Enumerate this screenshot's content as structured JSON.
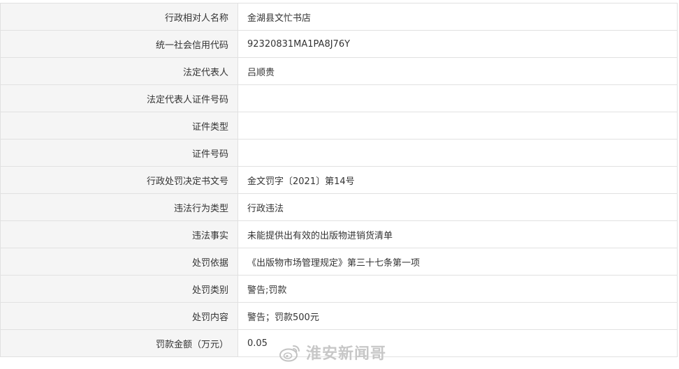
{
  "rows": [
    {
      "label": "行政相对人名称",
      "value": "金湖县文忙书店"
    },
    {
      "label": "统一社会信用代码",
      "value": "92320831MA1PA8J76Y"
    },
    {
      "label": "法定代表人",
      "value": "吕顺贵"
    },
    {
      "label": "法定代表人证件号码",
      "value": ""
    },
    {
      "label": "证件类型",
      "value": ""
    },
    {
      "label": "证件号码",
      "value": ""
    },
    {
      "label": "行政处罚决定书文号",
      "value": "金文罚字〔2021〕第14号"
    },
    {
      "label": "违法行为类型",
      "value": "行政违法"
    },
    {
      "label": "违法事实",
      "value": "未能提供出有效的出版物进销货清单"
    },
    {
      "label": "处罚依据",
      "value": "《出版物市场管理规定》第三十七条第一项"
    },
    {
      "label": "处罚类别",
      "value": "警告;罚款"
    },
    {
      "label": "处罚内容",
      "value": "警告；罚款500元"
    },
    {
      "label": "罚款金额（万元）",
      "value": "0.05"
    }
  ],
  "watermark": {
    "text": "淮安新闻哥",
    "icon": "weibo-icon"
  },
  "colors": {
    "label_bg": "#f5f5f5",
    "border": "#e1e1e1",
    "text": "#333333",
    "watermark": "#c2c2c2"
  }
}
